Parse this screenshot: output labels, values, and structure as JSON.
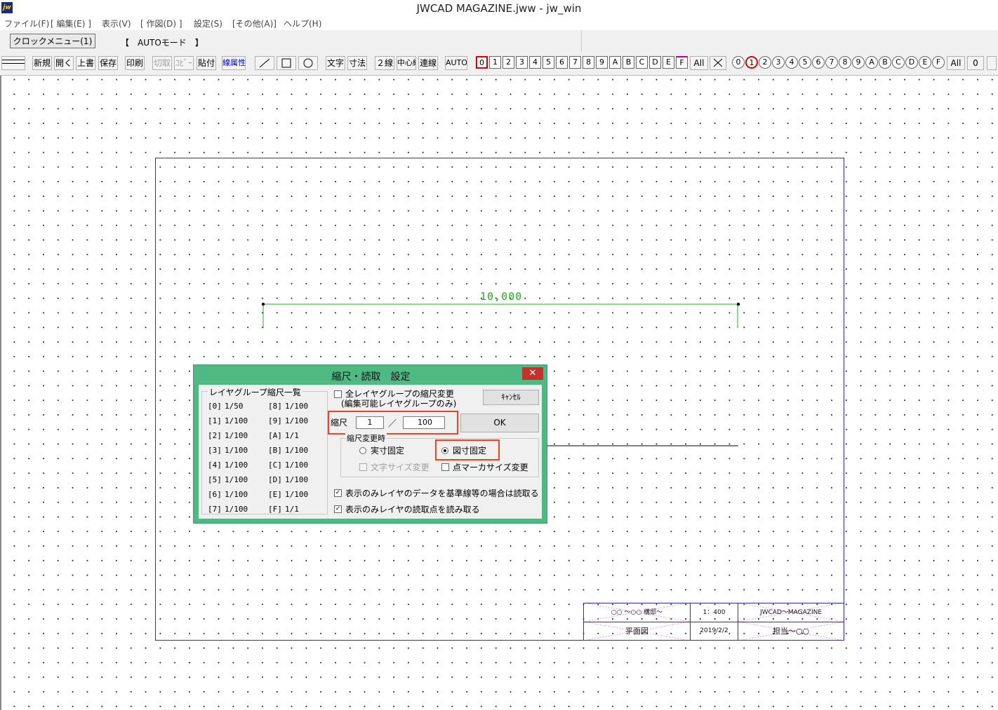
{
  "window": {
    "title": "JWCAD MAGAZINE.jww - jw_win",
    "app_icon": "jw"
  },
  "menu": [
    "ファイル(F)",
    "[ 編集(E) ]",
    "表示(V)",
    "[ 作図(D) ]",
    "設定(S)",
    "[その他(A)]",
    "ヘルプ(H)"
  ],
  "clock": {
    "button_label": "クロックメニュー(1)",
    "mode_label": "【　AUTOモード　】"
  },
  "toolbar": {
    "new": "新規",
    "open": "開く",
    "overwrite": "上書",
    "save": "保存",
    "print": "印刷",
    "cut": "切取",
    "copy": "ｺﾋﾟｰ",
    "paste": "貼付",
    "line_attr": "線属性",
    "text": "文字",
    "dimension": "寸法",
    "double_line": "２線",
    "center_line": "中心線",
    "continuous_line": "連線",
    "auto": "AUTO",
    "layer_all": "All",
    "group_all": "All",
    "zero_btn": "0",
    "layers": [
      "0",
      "1",
      "2",
      "3",
      "4",
      "5",
      "6",
      "7",
      "8",
      "9",
      "A",
      "B",
      "C",
      "D",
      "E",
      "F"
    ],
    "groups": [
      "0",
      "1",
      "2",
      "3",
      "4",
      "5",
      "6",
      "7",
      "8",
      "9",
      "A",
      "B",
      "C",
      "D",
      "E",
      "F"
    ]
  },
  "drawing": {
    "dimension_text": "10,000",
    "title_block": {
      "project": "○○ ～○○ 構邸～",
      "scale": "1：400",
      "company": "JWCAD～MAGAZINE",
      "drawing_name": "平面図",
      "date": "2019/2/2",
      "person": "担当～○○"
    },
    "colors": {
      "frame": "#2a2ad0",
      "dimension": "#19b419",
      "dialog_frame": "#4fb983",
      "highlight": "#ff3b1f"
    }
  },
  "dialog": {
    "title": "縮尺・読取　設定",
    "close_label": "✕",
    "group_list_title": "レイヤグループ縮尺一覧",
    "group_scales": [
      {
        "id": "[0]",
        "scale": "1/50"
      },
      {
        "id": "[1]",
        "scale": "1/100"
      },
      {
        "id": "[2]",
        "scale": "1/100"
      },
      {
        "id": "[3]",
        "scale": "1/100"
      },
      {
        "id": "[4]",
        "scale": "1/100"
      },
      {
        "id": "[5]",
        "scale": "1/100"
      },
      {
        "id": "[6]",
        "scale": "1/100"
      },
      {
        "id": "[7]",
        "scale": "1/100"
      },
      {
        "id": "[8]",
        "scale": "1/100"
      },
      {
        "id": "[9]",
        "scale": "1/100"
      },
      {
        "id": "[A]",
        "scale": "1/1"
      },
      {
        "id": "[B]",
        "scale": "1/100"
      },
      {
        "id": "[C]",
        "scale": "1/100"
      },
      {
        "id": "[D]",
        "scale": "1/100"
      },
      {
        "id": "[E]",
        "scale": "1/100"
      },
      {
        "id": "[F]",
        "scale": "1/1"
      }
    ],
    "all_groups_label": "全レイヤグループの縮尺変更",
    "all_groups_sub": "(編集可能レイヤグループのみ)",
    "cancel_label": "ｷｬﾝｾﾙ",
    "ok_label": "OK",
    "scale_label": "縮尺",
    "scale_numerator": "1",
    "scale_slash": "／",
    "scale_denominator": "100",
    "on_change_label": "縮尺変更時",
    "actual_fixed": "実寸固定",
    "drawing_fixed": "図寸固定",
    "text_size_change": "文字サイズ変更",
    "point_marker_change": "点マーカサイズ変更",
    "read_display_data": "表示のみレイヤのデータを基準線等の場合は読取る",
    "read_display_points": "表示のみレイヤの読取点を読み取る"
  }
}
